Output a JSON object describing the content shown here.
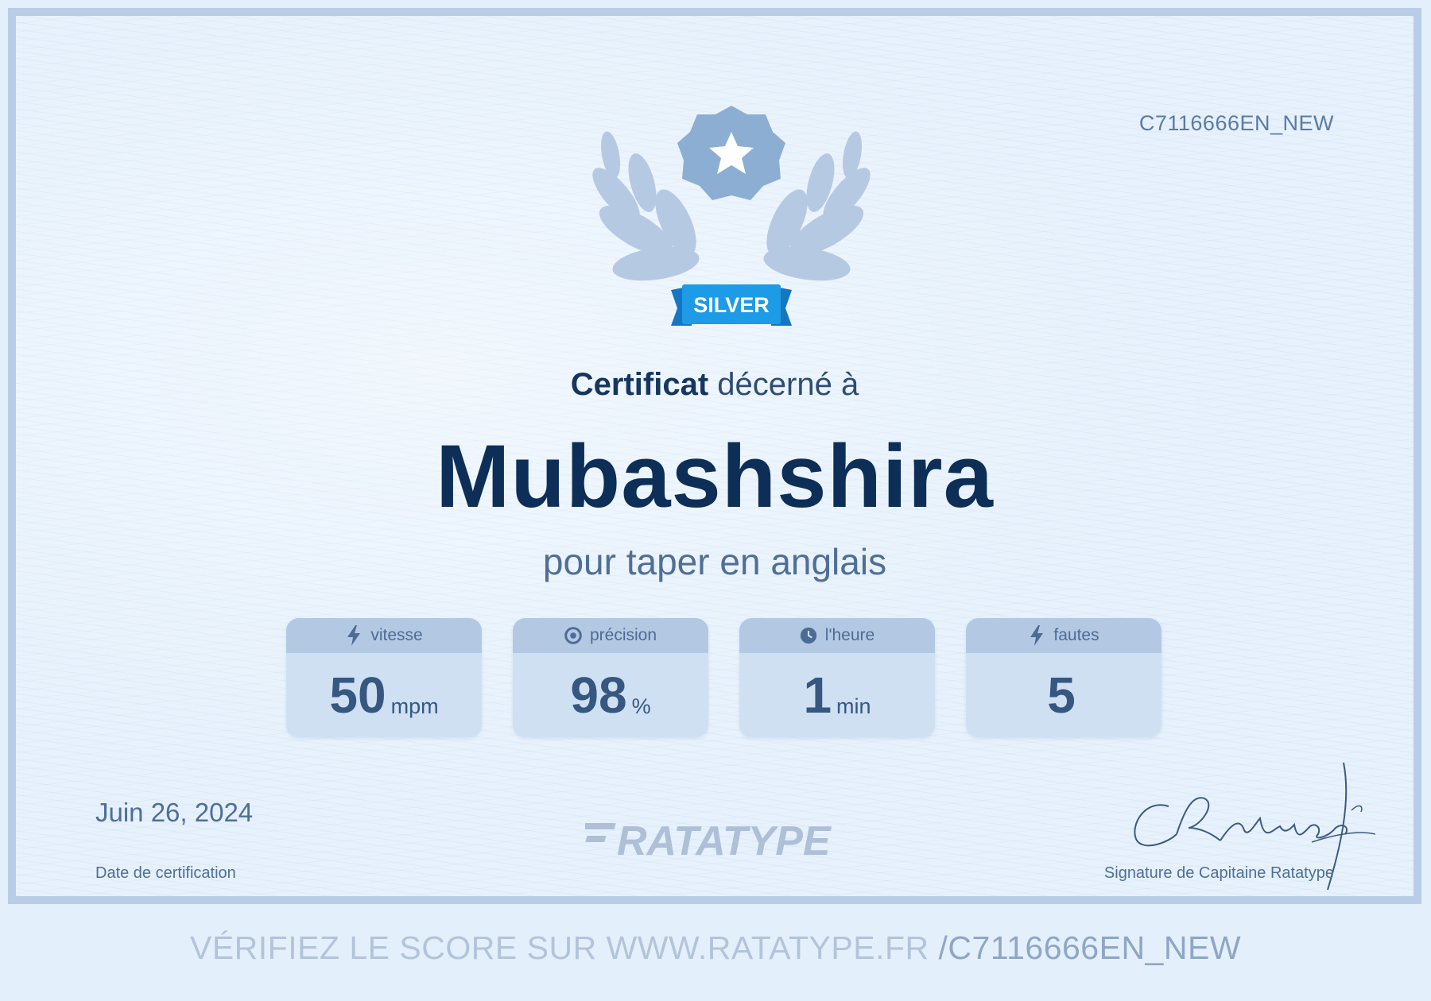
{
  "certificate": {
    "code": "C7116666EN_NEW",
    "badge": "SILVER",
    "heading_bold": "Certificat",
    "heading_rest": " décerné à",
    "recipient": "Mubashshira",
    "subtitle": "pour taper en anglais"
  },
  "stats": [
    {
      "label": "vitesse",
      "value": "50",
      "unit": "mpm",
      "icon": "lightning-icon"
    },
    {
      "label": "précision",
      "value": "98",
      "unit": "%",
      "icon": "target-icon"
    },
    {
      "label": "l'heure",
      "value": "1",
      "unit": "min",
      "icon": "clock-icon"
    },
    {
      "label": "fautes",
      "value": "5",
      "unit": "",
      "icon": "lightning-icon"
    }
  ],
  "footer": {
    "date": "Juin 26, 2024",
    "date_label": "Date de certification",
    "logo": "RATATYPE",
    "signature_text": "CRatatype",
    "signature_label": "Signature de Capitaine Ratatype"
  },
  "verify": {
    "text": "VÉRIFIEZ LE SCORE SUR WWW.RATATYPE.FR ",
    "code": "/C7116666EN_NEW"
  },
  "colors": {
    "primary_dark": "#0d2e57",
    "badge_ribbon": "#1e9be6",
    "laurel": "#b6c9e3",
    "medal": "#8daed3"
  }
}
